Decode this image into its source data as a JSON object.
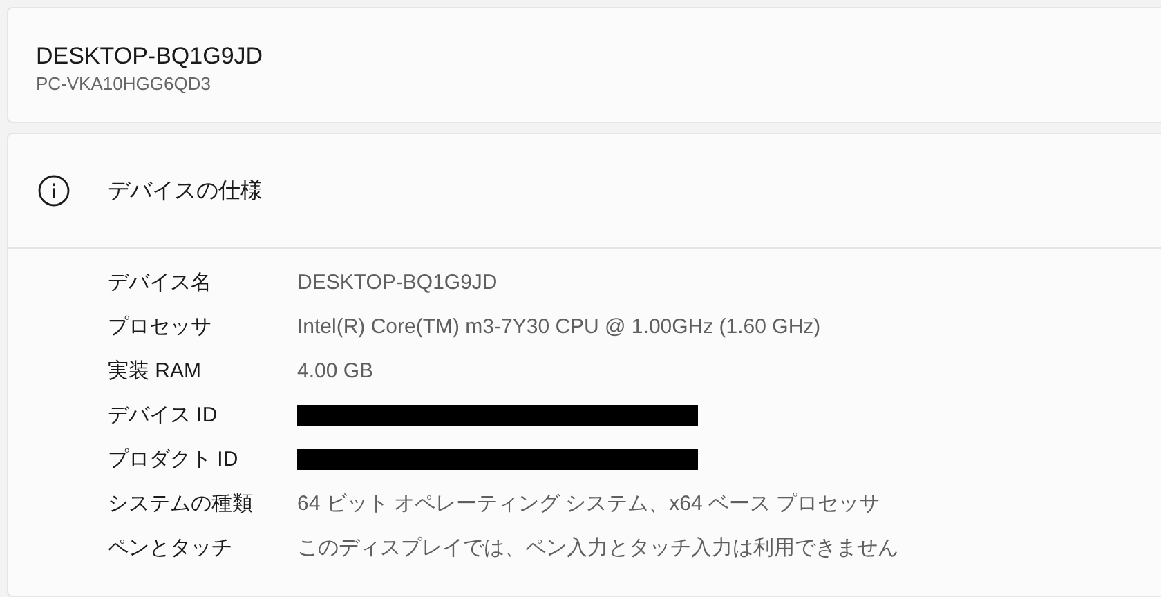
{
  "device_card": {
    "name": "DESKTOP-BQ1G9JD",
    "model": "PC-VKA10HGG6QD3"
  },
  "specs": {
    "title": "デバイスの仕様",
    "rows": [
      {
        "kind": "text",
        "label": "デバイス名",
        "value": "DESKTOP-BQ1G9JD"
      },
      {
        "kind": "text",
        "label": "プロセッサ",
        "value": "Intel(R) Core(TM) m3-7Y30 CPU @ 1.00GHz (1.60 GHz)"
      },
      {
        "kind": "text",
        "label": "実装 RAM",
        "value": "4.00 GB"
      },
      {
        "kind": "redacted",
        "label": "デバイス ID"
      },
      {
        "kind": "redacted",
        "label": "プロダクト ID"
      },
      {
        "kind": "text",
        "label": "システムの種類",
        "value": "64 ビット オペレーティング システム、x64 ベース プロセッサ"
      },
      {
        "kind": "text",
        "label": "ペンとタッチ",
        "value": "このディスプレイでは、ペン入力とタッチ入力は利用できません"
      }
    ]
  }
}
